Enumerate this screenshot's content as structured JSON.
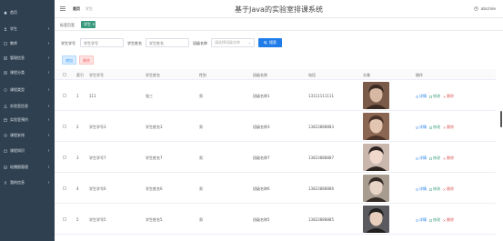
{
  "app": {
    "title": "基于Java的实验室排课系统"
  },
  "topbar": {
    "breadcrumb_home": "首页",
    "breadcrumb_current": "学生",
    "user": "abc/role"
  },
  "tagbar": {
    "label": "标签页签",
    "active_tag": "学生 ×"
  },
  "sidebar": {
    "items": [
      {
        "label": "首页",
        "icon": "home-icon",
        "has_children": false
      },
      {
        "label": "学生",
        "icon": "user-icon",
        "has_children": true
      },
      {
        "label": "教师",
        "icon": "teacher-icon",
        "has_children": true
      },
      {
        "label": "管理信息",
        "icon": "info-icon",
        "has_children": true
      },
      {
        "label": "课程分类",
        "icon": "category-icon",
        "has_children": true
      },
      {
        "label": "课程类型",
        "icon": "type-icon",
        "has_children": true
      },
      {
        "label": "实验室信息",
        "icon": "lab-icon",
        "has_children": true
      },
      {
        "label": "实验室预约",
        "icon": "booking-icon",
        "has_children": true
      },
      {
        "label": "课程安排",
        "icon": "schedule-icon",
        "has_children": true
      },
      {
        "label": "课程知识",
        "icon": "book-icon",
        "has_children": true
      },
      {
        "label": "轮播图管理",
        "icon": "image-icon",
        "has_children": true
      },
      {
        "label": "我的信息",
        "icon": "profile-icon",
        "has_children": true
      }
    ]
  },
  "search": {
    "field1_label": "学生学号",
    "field1_placeholder": "学生学号",
    "field2_label": "学生姓名",
    "field2_placeholder": "学生姓名",
    "field3_label": "班级名称",
    "field3_placeholder": "请选择班级名称",
    "button": "搜索"
  },
  "actions": {
    "add": "增加",
    "delete": "删除"
  },
  "table": {
    "headers": [
      "索引",
      "学生学号",
      "学生姓名",
      "性别",
      "班级名称",
      "电话",
      "头像",
      "操作"
    ],
    "ops": {
      "detail": "详情",
      "edit": "修改",
      "delete": "删除"
    },
    "rows": [
      {
        "index": "1",
        "student_id": "111",
        "name": "张三",
        "gender": "男",
        "class": "班级名称1",
        "phone": "13111111111",
        "avatar_palette": [
          "#7a5a48",
          "#d7b9a3",
          "#3a2a22"
        ]
      },
      {
        "index": "2",
        "student_id": "学生学号3",
        "name": "学生姓名3",
        "gender": "男",
        "class": "班级名称3",
        "phone": "13823888883",
        "avatar_palette": [
          "#8a6552",
          "#e3c6b2",
          "#4a3328"
        ]
      },
      {
        "index": "3",
        "student_id": "学生学号7",
        "name": "学生姓名7",
        "gender": "男",
        "class": "班级名称7",
        "phone": "13823888887",
        "avatar_palette": [
          "#c9b7ae",
          "#f0d9cc",
          "#2d2421"
        ]
      },
      {
        "index": "4",
        "student_id": "学生学号6",
        "name": "学生姓名6",
        "gender": "男",
        "class": "班级名称6",
        "phone": "13823888886",
        "avatar_palette": [
          "#a89b90",
          "#e8d4c6",
          "#332a24"
        ]
      },
      {
        "index": "5",
        "student_id": "学生学号5",
        "name": "学生姓名5",
        "gender": "男",
        "class": "班级名称5",
        "phone": "13823888885",
        "avatar_palette": [
          "#5b5a5e",
          "#e7cdbb",
          "#22201f"
        ]
      }
    ]
  },
  "colors": {
    "sidebar_bg": "#2f4050",
    "primary": "#1f7ce8",
    "tag_green": "#3a9a7e",
    "danger": "#e05c5c"
  }
}
